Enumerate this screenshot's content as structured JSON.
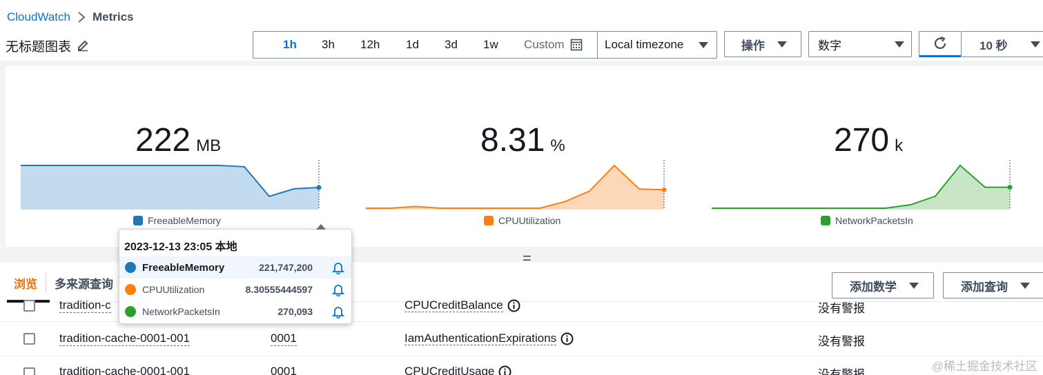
{
  "breadcrumb": {
    "root": "CloudWatch",
    "current": "Metrics"
  },
  "dashboard": {
    "title": "无标题图表"
  },
  "time_range": {
    "options": [
      "1h",
      "3h",
      "12h",
      "1d",
      "3d",
      "1w"
    ],
    "active": "1h",
    "custom_label": "Custom"
  },
  "timezone": {
    "value": "Local timezone"
  },
  "toolbar": {
    "actions_label": "操作",
    "view_type": "数字",
    "refresh_interval": "10 秒"
  },
  "colors": {
    "blue": "#1f77b4",
    "orange": "#ff7f0e",
    "green": "#2ca02c",
    "accent": "#0972d3",
    "tab_accent": "#ec7211"
  },
  "widgets": [
    {
      "value": "222",
      "unit": "MB",
      "metric": "FreeableMemory",
      "color": "#1f77b4"
    },
    {
      "value": "8.31",
      "unit": "%",
      "metric": "CPUUtilization",
      "color": "#ff7f0e"
    },
    {
      "value": "270",
      "unit": "k",
      "metric": "NetworkPacketsIn",
      "color": "#2ca02c"
    }
  ],
  "chart_data": [
    {
      "type": "area",
      "series": [
        {
          "name": "FreeableMemory",
          "values": [
            0.0,
            0.0,
            0.0,
            0.0,
            0.0,
            0.0,
            0.0,
            0.0,
            0.0,
            0.03,
            0.7,
            0.53,
            0.5
          ]
        }
      ]
    },
    {
      "type": "area",
      "series": [
        {
          "name": "CPUUtilization",
          "values": [
            0.0,
            0.0,
            0.04,
            0.0,
            0.0,
            0.0,
            0.0,
            0.0,
            0.15,
            0.4,
            1.0,
            0.45,
            0.43
          ]
        }
      ]
    },
    {
      "type": "area",
      "series": [
        {
          "name": "NetworkPacketsIn",
          "values": [
            0.0,
            0.0,
            0.0,
            0.0,
            0.0,
            0.0,
            0.0,
            0.0,
            0.08,
            0.28,
            1.0,
            0.49,
            0.49
          ]
        }
      ]
    }
  ],
  "tooltip": {
    "title": "2023-12-13 23:05 本地",
    "rows": [
      {
        "name": "FreeableMemory",
        "value": "221,747,200",
        "color": "#1f77b4"
      },
      {
        "name": "CPUUtilization",
        "value": "8.30555444597",
        "color": "#ff7f0e"
      },
      {
        "name": "NetworkPacketsIn",
        "value": "270,093",
        "color": "#2ca02c"
      }
    ]
  },
  "tabs": {
    "browse": "浏览",
    "multi_source": "多来源查询"
  },
  "buttons": {
    "add_math": "添加数学",
    "add_query": "添加查询"
  },
  "rows": [
    {
      "name": "tradition-c",
      "id": "",
      "metric": "CPUCreditBalance",
      "alarm": "没有警报"
    },
    {
      "name": "tradition-cache-0001-001",
      "id": "0001",
      "metric": "IamAuthenticationExpirations",
      "alarm": "没有警报"
    },
    {
      "name": "tradition-cache-0001-001",
      "id": "0001",
      "metric": "CPUCreditUsage",
      "alarm": "没有警报"
    }
  ],
  "watermark": "@稀土掘金技术社区"
}
